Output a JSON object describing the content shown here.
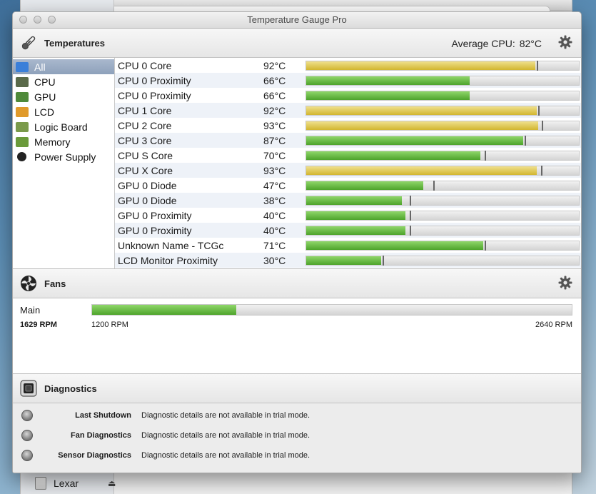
{
  "background_window": {
    "sidebar_bottom_item": "Lexar"
  },
  "window": {
    "title": "Temperature Gauge Pro"
  },
  "temperatures": {
    "title": "Temperatures",
    "average_label": "Average CPU:",
    "average_value": "82°C",
    "sidebar": [
      {
        "label": "All",
        "selected": true
      },
      {
        "label": "CPU"
      },
      {
        "label": "GPU"
      },
      {
        "label": "LCD"
      },
      {
        "label": "Logic Board"
      },
      {
        "label": "Memory"
      },
      {
        "label": "Power Supply"
      }
    ],
    "sensors": [
      {
        "name": "CPU 0 Core",
        "value": "92°C",
        "level": 0.84,
        "max": 0.845,
        "color": "yellow"
      },
      {
        "name": "CPU 0 Proximity",
        "value": "66°C",
        "level": 0.6,
        "color": "green"
      },
      {
        "name": "CPU 0 Proximity",
        "value": "66°C",
        "level": 0.6,
        "color": "green"
      },
      {
        "name": "CPU 1 Core",
        "value": "92°C",
        "level": 0.845,
        "max": 0.85,
        "color": "yellow"
      },
      {
        "name": "CPU 2 Core",
        "value": "93°C",
        "level": 0.85,
        "max": 0.865,
        "color": "yellow"
      },
      {
        "name": "CPU 3 Core",
        "value": "87°C",
        "level": 0.795,
        "max": 0.8,
        "color": "green"
      },
      {
        "name": "CPU S Core",
        "value": "70°C",
        "level": 0.64,
        "max": 0.655,
        "color": "green"
      },
      {
        "name": "CPU X Core",
        "value": "93°C",
        "level": 0.845,
        "max": 0.86,
        "color": "yellow"
      },
      {
        "name": "GPU 0 Diode",
        "value": "47°C",
        "level": 0.43,
        "max": 0.465,
        "color": "green"
      },
      {
        "name": "GPU 0 Diode",
        "value": "38°C",
        "level": 0.35,
        "max": 0.38,
        "color": "green"
      },
      {
        "name": "GPU 0 Proximity",
        "value": "40°C",
        "level": 0.365,
        "max": 0.38,
        "color": "green"
      },
      {
        "name": "GPU 0 Proximity",
        "value": "40°C",
        "level": 0.365,
        "max": 0.38,
        "color": "green"
      },
      {
        "name": "Unknown Name - TCGc",
        "value": "71°C",
        "level": 0.65,
        "max": 0.655,
        "color": "green"
      },
      {
        "name": "LCD Monitor Proximity",
        "value": "30°C",
        "level": 0.275,
        "max": 0.28,
        "color": "green"
      }
    ]
  },
  "fans": {
    "title": "Fans",
    "items": [
      {
        "name": "Main",
        "rpm": "1629 RPM",
        "min": "1200 RPM",
        "max": "2640 RPM",
        "level": 0.3
      }
    ]
  },
  "diagnostics": {
    "title": "Diagnostics",
    "items": [
      {
        "label": "Last Shutdown",
        "detail": "Diagnostic details are not available in trial mode."
      },
      {
        "label": "Fan Diagnostics",
        "detail": "Diagnostic details are not available in trial mode."
      },
      {
        "label": "Sensor Diagnostics",
        "detail": "Diagnostic details are not available in trial mode."
      }
    ]
  },
  "colors": {
    "green": "#5fb33a",
    "yellow": "#d9c046",
    "selection": "#97a8c1"
  }
}
